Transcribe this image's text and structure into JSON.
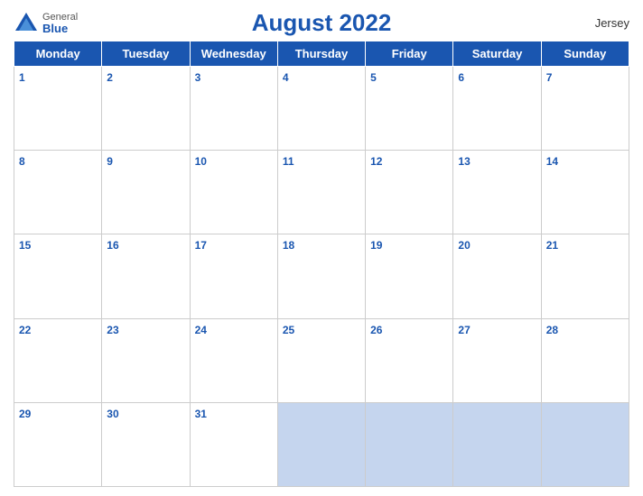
{
  "header": {
    "title": "August 2022",
    "region": "Jersey",
    "logo_general": "General",
    "logo_blue": "Blue"
  },
  "days": [
    "Monday",
    "Tuesday",
    "Wednesday",
    "Thursday",
    "Friday",
    "Saturday",
    "Sunday"
  ],
  "weeks": [
    [
      1,
      2,
      3,
      4,
      5,
      6,
      7
    ],
    [
      8,
      9,
      10,
      11,
      12,
      13,
      14
    ],
    [
      15,
      16,
      17,
      18,
      19,
      20,
      21
    ],
    [
      22,
      23,
      24,
      25,
      26,
      27,
      28
    ],
    [
      29,
      30,
      31,
      null,
      null,
      null,
      null
    ]
  ],
  "colors": {
    "header_bg": "#1a56b0",
    "empty_cell_bg": "#c5d5ee"
  }
}
